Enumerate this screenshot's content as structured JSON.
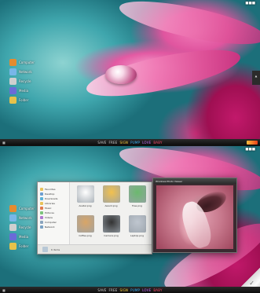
{
  "taskbar": {
    "items": [
      {
        "label": "SAVE",
        "color": "#cfcfcf"
      },
      {
        "label": "FREE",
        "color": "#cfcfcf"
      },
      {
        "label": "SIGN",
        "color": "#ffd23a"
      },
      {
        "label": "PUMP",
        "color": "#3ab5ff"
      },
      {
        "label": "LOVE",
        "color": "#c86bff"
      },
      {
        "label": "BABY",
        "color": "#ff4b6b"
      }
    ]
  },
  "desktop_icons": [
    {
      "label": "Computer",
      "icon": "computer-icon",
      "color": "#e58b2f"
    },
    {
      "label": "Network",
      "icon": "network-icon",
      "color": "#78b6e8"
    },
    {
      "label": "Recycle",
      "icon": "recycle-bin-icon",
      "color": "#cfcfcf"
    },
    {
      "label": "Media",
      "icon": "media-icon",
      "color": "#6a6bd8"
    },
    {
      "label": "Folder",
      "icon": "folder-icon",
      "color": "#e6c24a"
    }
  ],
  "explorer": {
    "nav": [
      {
        "label": "Favorites",
        "color": "#e8c25a"
      },
      {
        "label": "Desktop",
        "color": "#6d9ed0"
      },
      {
        "label": "Downloads",
        "color": "#5cb2d9"
      },
      {
        "label": "Libraries",
        "color": "#e8c25a"
      },
      {
        "label": "Music",
        "color": "#e07b4f"
      },
      {
        "label": "Pictures",
        "color": "#7bc47b"
      },
      {
        "label": "Videos",
        "color": "#b07bd0"
      },
      {
        "label": "Computer",
        "color": "#8aa4bd"
      },
      {
        "label": "Network",
        "color": "#7aa1c4"
      }
    ],
    "files": [
      {
        "label": "Avatar.png",
        "icon": "avatar-icon",
        "color": "#ffffff"
      },
      {
        "label": "Award.png",
        "icon": "award-icon",
        "color": "#f2c14e"
      },
      {
        "label": "Tree.png",
        "icon": "tree-icon",
        "color": "#6bb96e"
      },
      {
        "label": "Coffee.png",
        "icon": "coffee-icon",
        "color": "#d9a566"
      },
      {
        "label": "Camera.png",
        "icon": "camera-icon",
        "color": "#333333"
      },
      {
        "label": "Laptop.png",
        "icon": "laptop-icon",
        "color": "#bfc6cf"
      }
    ],
    "status": "6 items"
  },
  "viewer": {
    "title": "Windows Photo Viewer"
  },
  "colors": {
    "accent": "#e2579f",
    "teal": "#3fa6ad"
  }
}
